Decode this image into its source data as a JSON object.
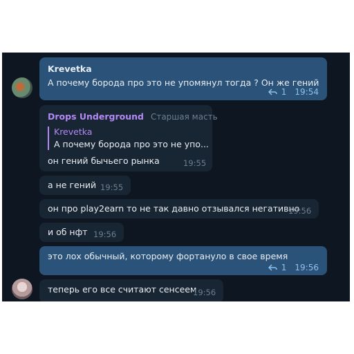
{
  "messages": [
    {
      "sender": "Krevetka",
      "text": "А почему борода про это не упомянул тогда ? Он же гений",
      "reply_count": "1",
      "time": "19:54"
    },
    {
      "sender": "Drops Underground",
      "role": "Старшая масть",
      "quote_sender": "Krevetka",
      "quote_text": "А почему борода про это не упо...",
      "text": "он гений бычьего рынка",
      "time": "19:55"
    },
    {
      "text": "а не гений",
      "time": "19:55"
    },
    {
      "text": "он про play2earn то не так давно отзывался негативно",
      "time": "19:56"
    },
    {
      "text": "и об нфт",
      "time": "19:56"
    },
    {
      "text": "это лох обычный, которому фортануло в свое время",
      "reply_count": "1",
      "time": "19:56"
    },
    {
      "text": "теперь его все считают сенсеем",
      "time": "19:56"
    }
  ],
  "icons": {
    "reply": "reply-arrow-icon"
  },
  "colors": {
    "background": "#0e1621",
    "outgoing": "#2b5278",
    "incoming": "#182533",
    "accent": "#b389f5"
  }
}
